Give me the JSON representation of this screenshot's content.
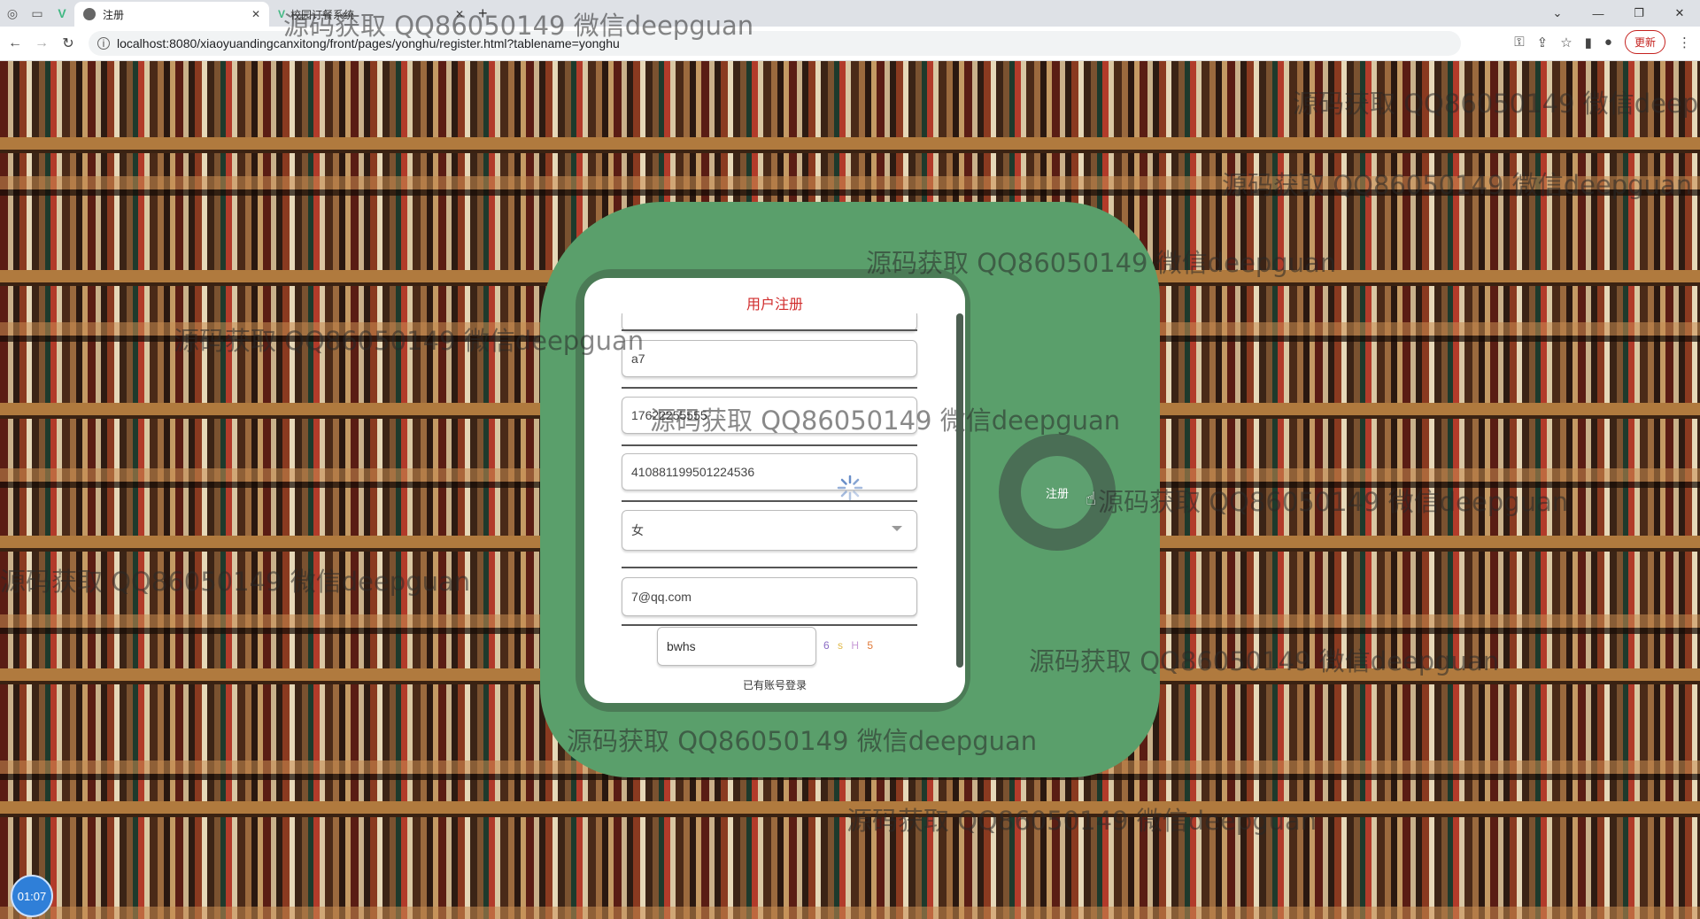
{
  "browser": {
    "tabs": [
      {
        "label": "注册",
        "active": true
      },
      {
        "label": "校园订餐系统",
        "active": false
      }
    ],
    "url": "localhost:8080/xiaoyuandingcanxitong/front/pages/yonghu/register.html?tablename=yonghu",
    "update_label": "更新",
    "new_tab": "+"
  },
  "form": {
    "title": "用户注册",
    "fields": {
      "name": "a7",
      "phone": "17622255555",
      "id_card": "410881199501224536",
      "gender": "女",
      "email": "7@qq.com",
      "captcha_input": "bwhs"
    },
    "captcha_code": [
      "6",
      "s",
      "H",
      "5"
    ],
    "login_link": "已有账号登录",
    "register_button": "注册"
  },
  "timer": "01:07",
  "watermarks": [
    "源码获取 QQ86050149 微信deepguan"
  ],
  "colors": {
    "card_green": "#5a9f6b",
    "title_red": "#d12c2c",
    "timer_blue": "#2f7fd8"
  }
}
